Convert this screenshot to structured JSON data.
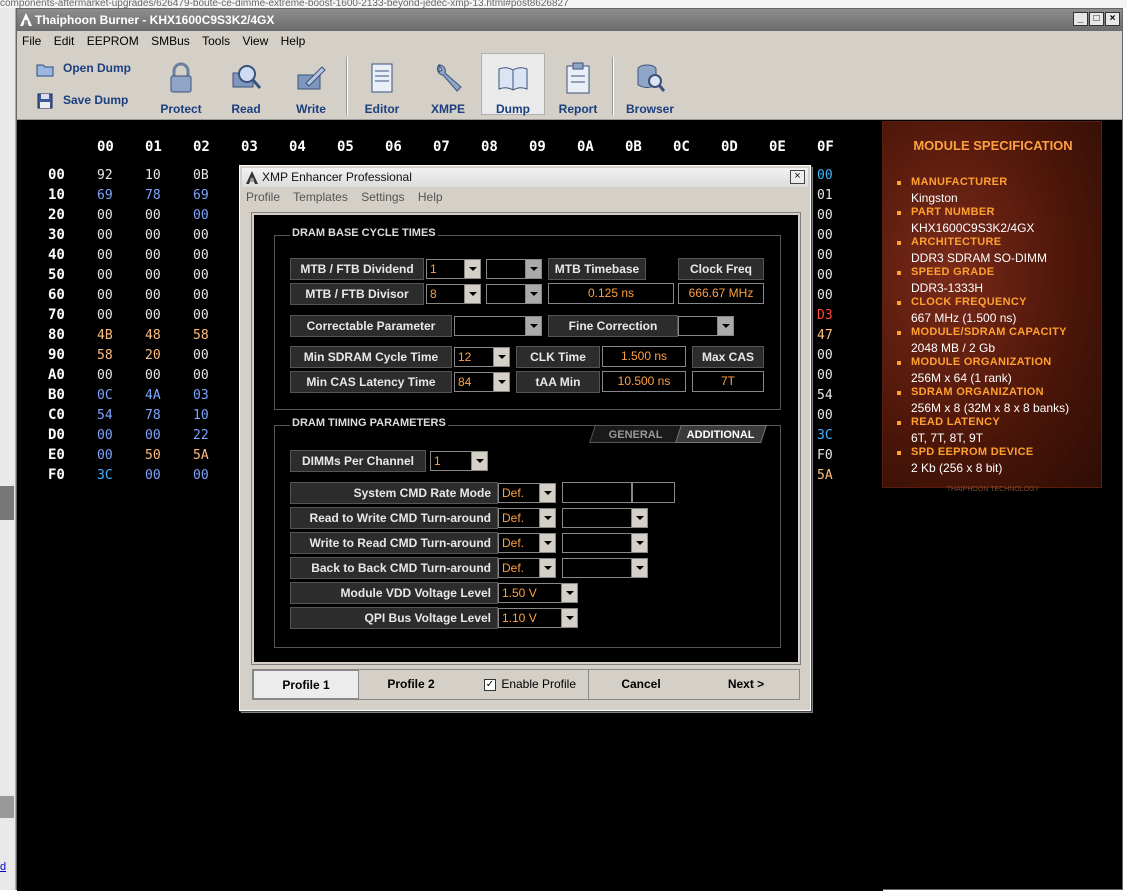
{
  "browser_bg": {
    "url_text": "components-aftermarket-upgrades/626479-boute-ce-dimme-extreme-boost-1600-2133-beyond-jedec-xmp-13.html#post8626827"
  },
  "side_link": {
    "text": "d"
  },
  "window": {
    "title": "Thaiphoon Burner - KHX1600C9S3K2/4GX",
    "minimize": "_",
    "maximize": "□",
    "close": "×"
  },
  "menu": [
    "File",
    "Edit",
    "EEPROM",
    "SMBus",
    "Tools",
    "View",
    "Help"
  ],
  "toolbar": {
    "open_dump": "Open Dump",
    "save_dump": "Save Dump",
    "protect": "Protect",
    "read": "Read",
    "write": "Write",
    "editor": "Editor",
    "xmpe": "XMPE",
    "dump": "Dump",
    "report": "Report",
    "browser": "Browser"
  },
  "hex": {
    "columns": [
      "00",
      "01",
      "02",
      "03",
      "04",
      "05",
      "06",
      "07",
      "08",
      "09",
      "0A",
      "0B",
      "0C",
      "0D",
      "0E",
      "0F"
    ],
    "rows": [
      {
        "label": "00",
        "left": [
          "92",
          "10",
          "0B"
        ],
        "right": "00"
      },
      {
        "label": "10",
        "left": [
          "69",
          "78",
          "69"
        ],
        "right": "01"
      },
      {
        "label": "20",
        "left": [
          "00",
          "00",
          "00"
        ],
        "right": "00"
      },
      {
        "label": "30",
        "left": [
          "00",
          "00",
          "00"
        ],
        "right": "00"
      },
      {
        "label": "40",
        "left": [
          "00",
          "00",
          "00"
        ],
        "right": "00"
      },
      {
        "label": "50",
        "left": [
          "00",
          "00",
          "00"
        ],
        "right": "00"
      },
      {
        "label": "60",
        "left": [
          "00",
          "00",
          "00"
        ],
        "right": "00"
      },
      {
        "label": "70",
        "left": [
          "00",
          "00",
          "00"
        ],
        "right": "D3"
      },
      {
        "label": "80",
        "left": [
          "4B",
          "48",
          "58"
        ],
        "right": "47"
      },
      {
        "label": "90",
        "left": [
          "58",
          "20",
          "00"
        ],
        "right": "00"
      },
      {
        "label": "A0",
        "left": [
          "00",
          "00",
          "00"
        ],
        "right": "00"
      },
      {
        "label": "B0",
        "left": [
          "0C",
          "4A",
          "03"
        ],
        "right": "54"
      },
      {
        "label": "C0",
        "left": [
          "54",
          "78",
          "10"
        ],
        "right": "00"
      },
      {
        "label": "D0",
        "left": [
          "00",
          "00",
          "22"
        ],
        "right": "3C"
      },
      {
        "label": "E0",
        "left": [
          "00",
          "50",
          "5A"
        ],
        "right": "F0"
      },
      {
        "label": "F0",
        "left": [
          "3C",
          "00",
          "00"
        ],
        "right": "5A"
      }
    ],
    "colors": {
      "white": "#ffffff",
      "blue": "#7ea6ff",
      "orange": "#ffbf7f",
      "red": "#ff4a3a",
      "cyan": "#3fb6ff"
    }
  },
  "spec": {
    "title": "MODULE SPECIFICATION",
    "items": [
      {
        "label": "MANUFACTURER",
        "value": "Kingston"
      },
      {
        "label": "PART NUMBER",
        "value": "KHX1600C9S3K2/4GX"
      },
      {
        "label": "ARCHITECTURE",
        "value": "DDR3 SDRAM SO-DIMM"
      },
      {
        "label": "SPEED GRADE",
        "value": "DDR3-1333H"
      },
      {
        "label": "CLOCK FREQUENCY",
        "value": "667 MHz (1.500 ns)"
      },
      {
        "label": "MODULE/SDRAM CAPACITY",
        "value": "2048 MB / 2 Gb"
      },
      {
        "label": "MODULE ORGANIZATION",
        "value": "256M x 64 (1 rank)"
      },
      {
        "label": "SDRAM ORGANIZATION",
        "value": "256M x 8 (32M x 8 x 8 banks)"
      },
      {
        "label": "READ LATENCY",
        "value": "6T, 7T, 8T, 9T"
      },
      {
        "label": "SPD EEPROM DEVICE",
        "value": "2 Kb (256 x 8 bit)"
      }
    ],
    "footer": "THAIPHOON TECHNOLOGY"
  },
  "dialog": {
    "title": "XMP Enhancer Professional",
    "close": "×",
    "menu": [
      "Profile",
      "Templates",
      "Settings",
      "Help"
    ],
    "base": {
      "group_label": "DRAM BASE CYCLE TIMES",
      "dividend_label": "MTB / FTB Dividend",
      "dividend_value": "1",
      "divisor_label": "MTB / FTB Divisor",
      "divisor_value": "8",
      "mtb_timebase_label": "MTB Timebase",
      "mtb_timebase_value": "0.125 ns",
      "clock_freq_label": "Clock Freq",
      "clock_freq_value": "666.67 MHz",
      "correctable_label": "Correctable Parameter",
      "fine_correction_label": "Fine Correction",
      "min_cycle_label": "Min SDRAM Cycle Time",
      "min_cycle_value": "12",
      "clk_time_label": "CLK Time",
      "clk_time_value": "1.500 ns",
      "max_cas_label": "Max CAS",
      "min_cas_label": "Min CAS Latency Time",
      "min_cas_value": "84",
      "taa_label": "tAA Min",
      "taa_value": "10.500 ns",
      "max_cas_value": "7T"
    },
    "timing": {
      "group_label": "DRAM TIMING PARAMETERS",
      "tab_general": "GENERAL",
      "tab_additional": "ADDITIONAL",
      "dimms_label": "DIMMs Per Channel",
      "dimms_value": "1",
      "cmd_rate_label": "System CMD Rate Mode",
      "cmd_rate_value": "Def.",
      "r2w_label": "Read to Write CMD Turn-around",
      "r2w_value": "Def.",
      "w2r_label": "Write to Read CMD Turn-around",
      "w2r_value": "Def.",
      "b2b_label": "Back to Back CMD Turn-around",
      "b2b_value": "Def.",
      "vdd_label": "Module VDD Voltage Level",
      "vdd_value": "1.50 V",
      "qpi_label": "QPI Bus Voltage Level",
      "qpi_value": "1.10 V"
    },
    "footer": {
      "profile1": "Profile 1",
      "profile2": "Profile 2",
      "enable_profile": "Enable Profile",
      "enable_checked": "✓",
      "cancel": "Cancel",
      "next": "Next >"
    }
  }
}
